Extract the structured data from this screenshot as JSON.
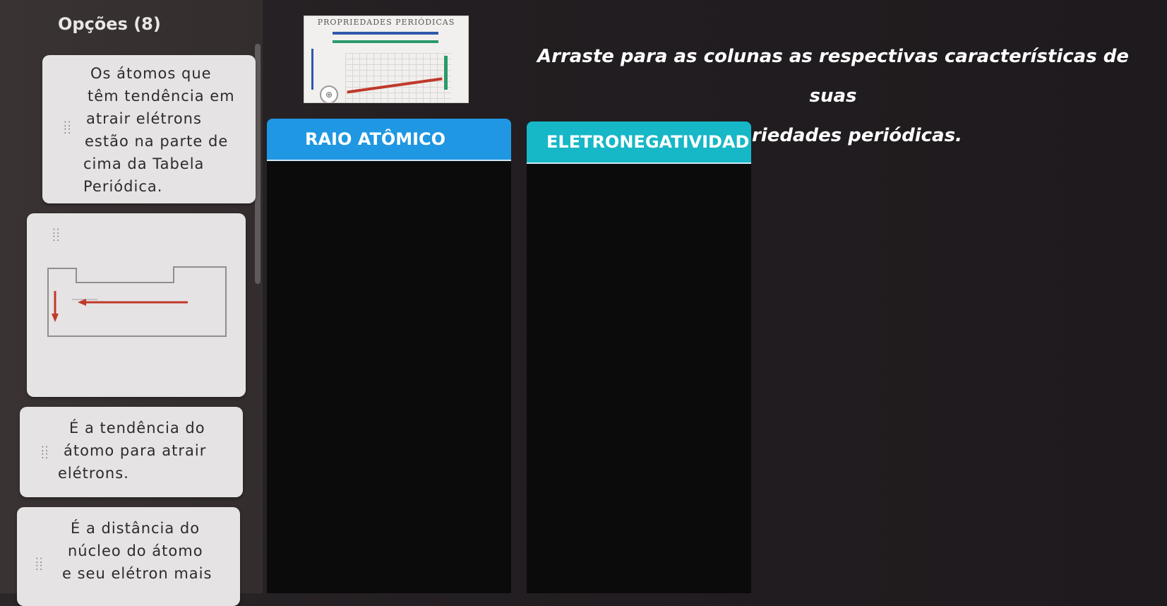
{
  "options": {
    "title": "Opções (8)",
    "cards": [
      {
        "lines": [
          "Os átomos que",
          "têm tendência em",
          "atrair elétrons",
          "estão na parte de",
          "cima da Tabela",
          "Periódica."
        ]
      },
      {
        "image": "periodic-table-trend-diagram"
      },
      {
        "lines": [
          "É a tendência do",
          "átomo para atrair",
          "elétrons."
        ]
      },
      {
        "lines": [
          "É a distância do",
          "núcleo do átomo",
          "e seu elétron mais"
        ]
      }
    ]
  },
  "figure": {
    "title": "PROPRIEDADES PERIÓDICAS"
  },
  "instruction": {
    "line1": "Arraste para as colunas as respectivas características de suas",
    "line2": "propriedades periódicas."
  },
  "columns": [
    {
      "label": "RAIO ATÔMICO",
      "color": "#1f97e3"
    },
    {
      "label": "ELETRONEGATIVIDAD",
      "color": "#16b7c6"
    }
  ],
  "colors": {
    "background": "#231e21",
    "card": "#e6e3e4",
    "drop_zone": "#0b0b0c",
    "arrow_red": "#c0392b"
  }
}
